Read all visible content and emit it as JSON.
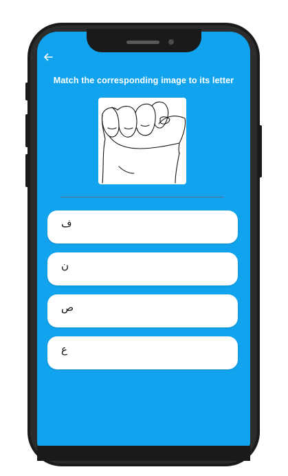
{
  "header": {
    "back_icon": "arrow-left-icon",
    "title": "Match the corresponding image to its letter"
  },
  "question": {
    "image_description_icon": "fist-hand-sign-icon"
  },
  "options": [
    {
      "letter": "ف"
    },
    {
      "letter": "ن"
    },
    {
      "letter": "ص"
    },
    {
      "letter": "ع"
    }
  ],
  "colors": {
    "screen_background": "#11a3ee",
    "card_background": "#ffffff",
    "frame": "#1a1a1a"
  }
}
